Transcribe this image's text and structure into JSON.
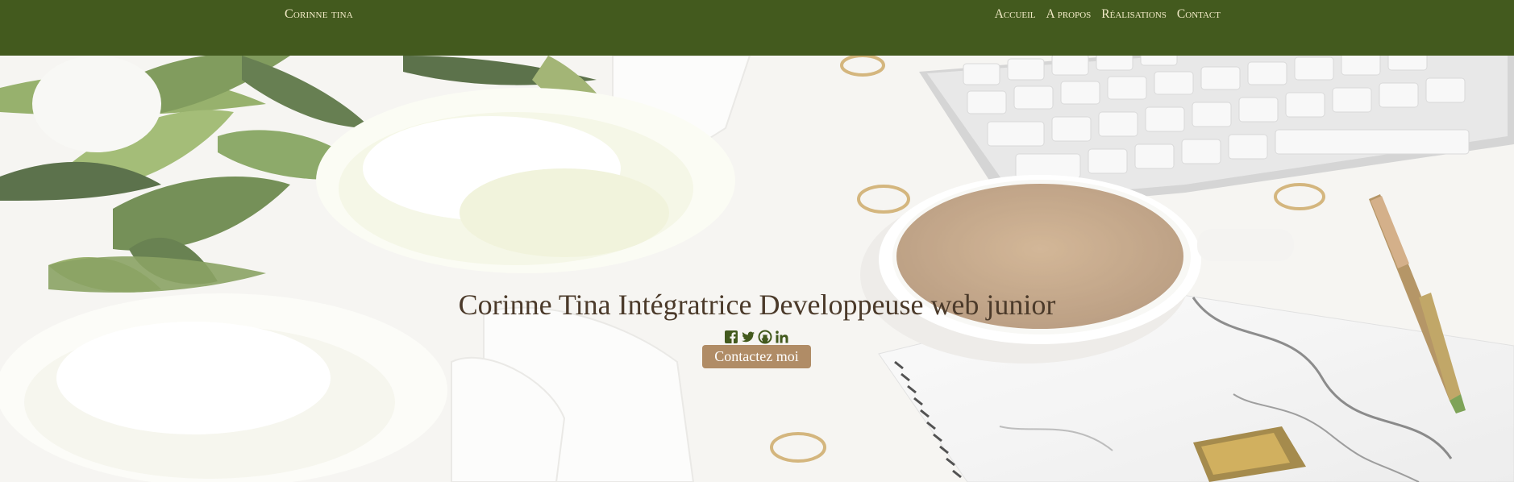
{
  "navbar": {
    "brand": "Corinne tina",
    "links": [
      "Accueil",
      "A propos",
      "Réalisations",
      "Contact"
    ]
  },
  "hero": {
    "headline": "Corinne Tina Intégratrice Developpeuse web junior",
    "cta_label": "Contactez moi",
    "social_icons": [
      "facebook-icon",
      "twitter-icon",
      "github-icon",
      "linkedin-icon"
    ]
  },
  "colors": {
    "navbar_bg": "#435a1e",
    "nav_text": "#f3ebc8",
    "headline": "#4b3a2a",
    "cta_bg": "#b08c66",
    "social_icon": "#435a1e"
  }
}
